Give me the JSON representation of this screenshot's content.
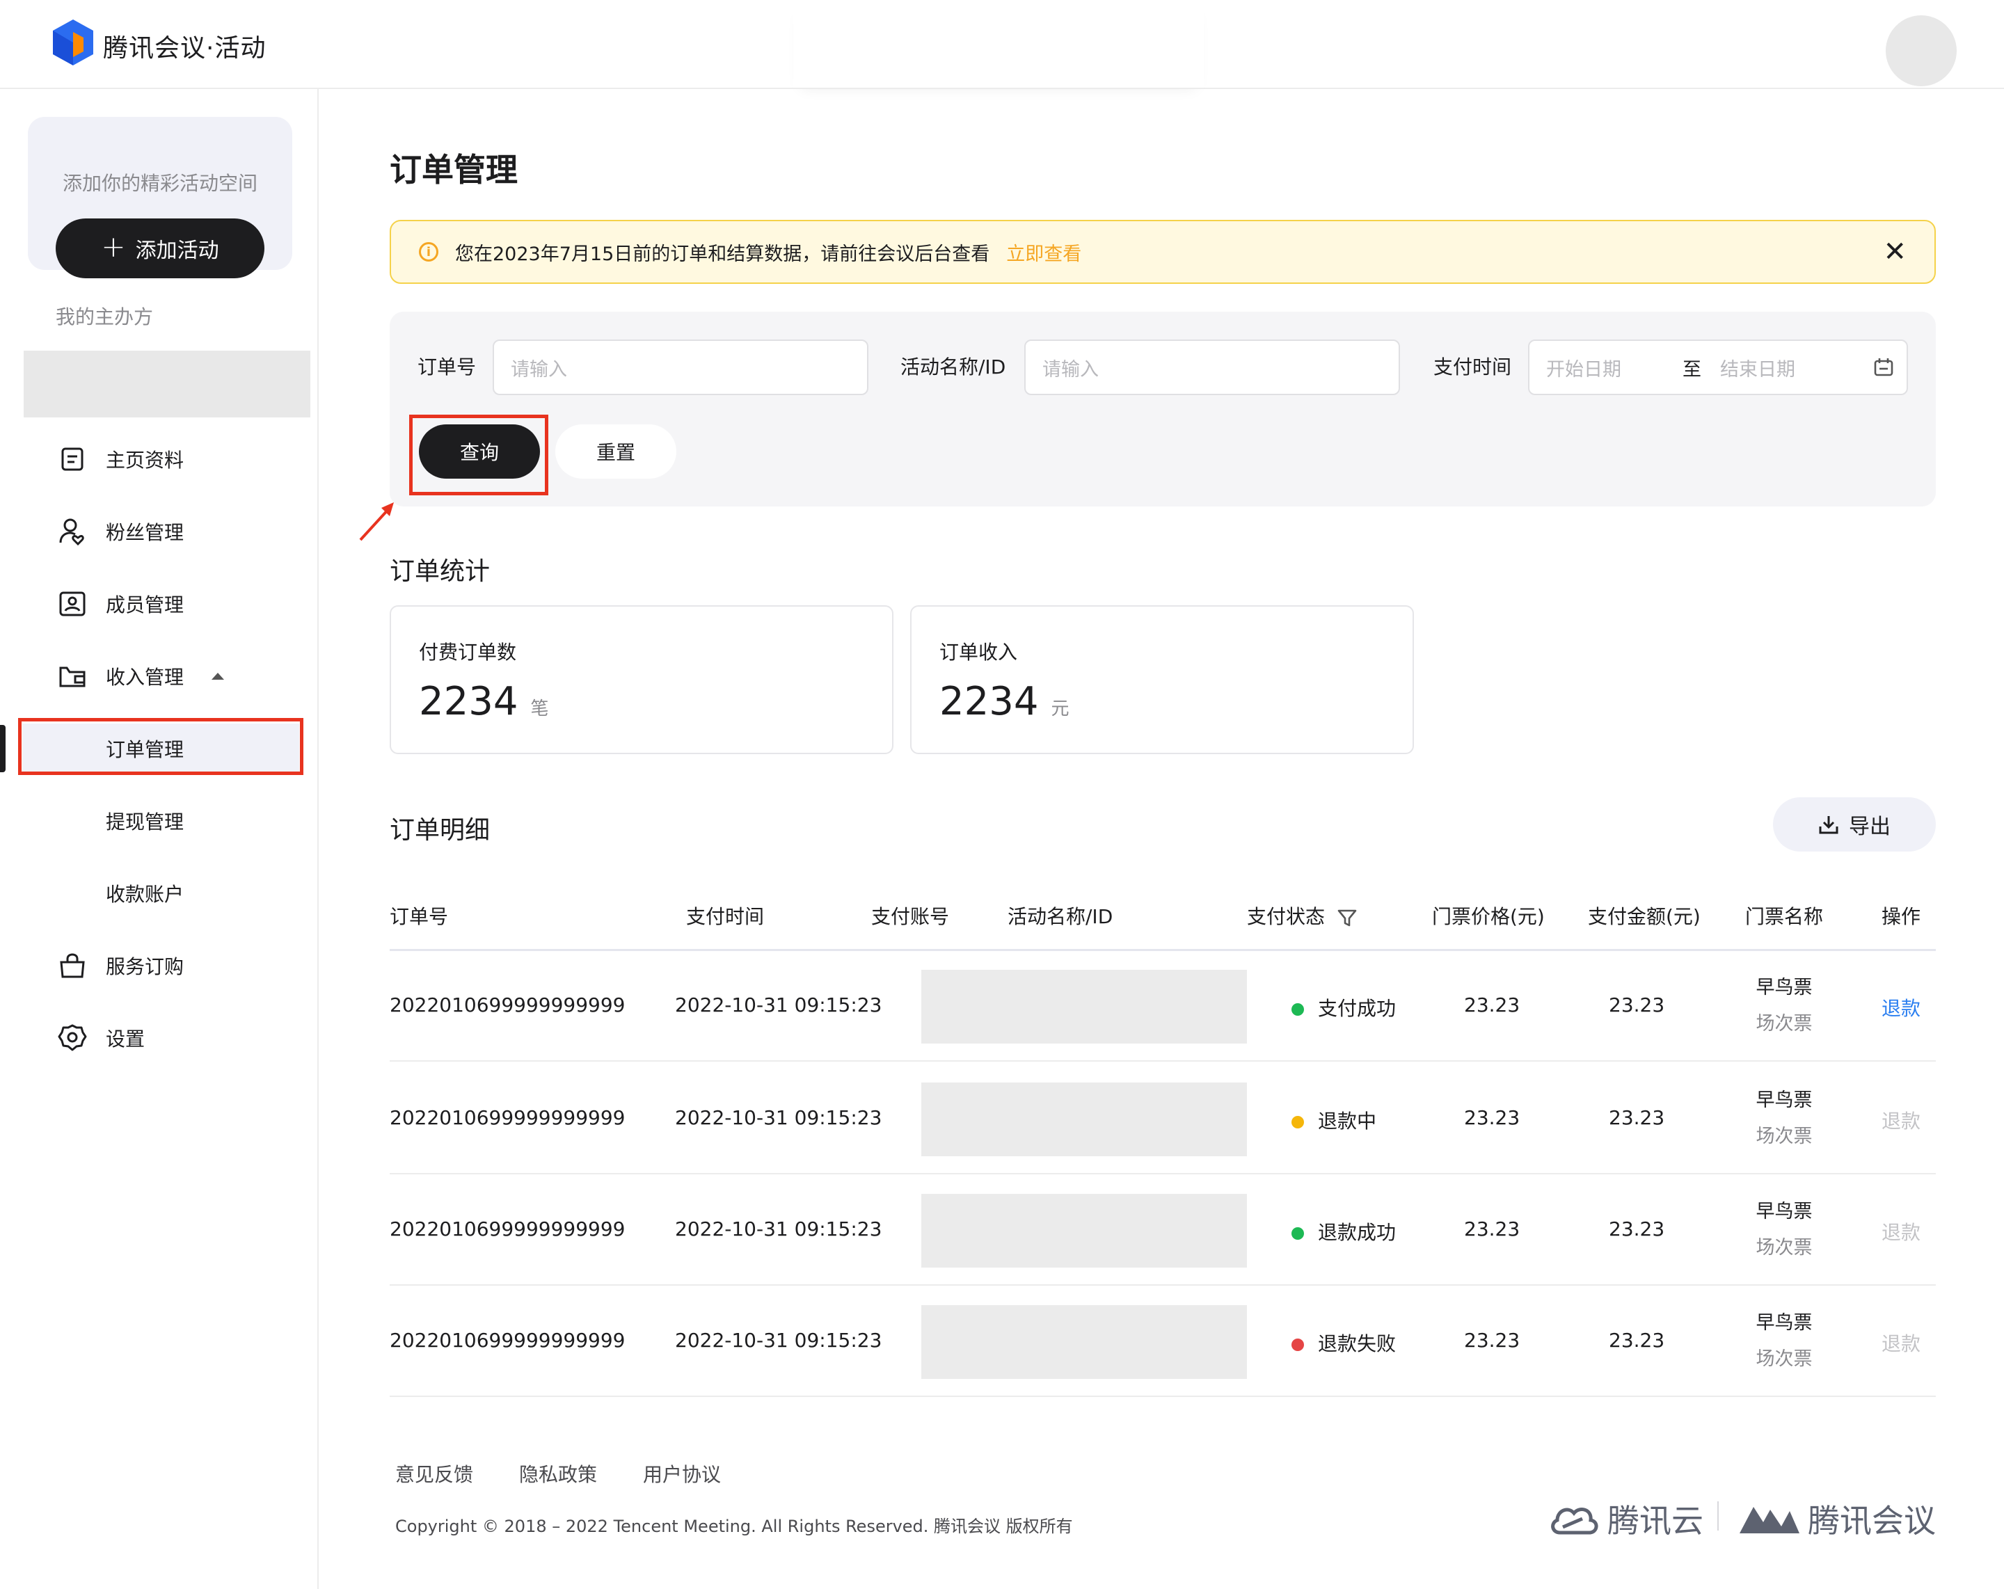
{
  "app": {
    "brand": "腾讯会议·活动"
  },
  "sidebar": {
    "promo_text": "添加你的精彩活动空间",
    "add_button": "添加活动",
    "org_label": "我的主办方",
    "items": [
      {
        "label": "主页资料",
        "icon": "document-icon"
      },
      {
        "label": "粉丝管理",
        "icon": "user-heart-icon"
      },
      {
        "label": "成员管理",
        "icon": "member-card-icon"
      },
      {
        "label": "收入管理",
        "icon": "wallet-icon"
      },
      {
        "label": "服务订购",
        "icon": "shopping-bag-icon"
      },
      {
        "label": "设置",
        "icon": "gear-icon"
      }
    ],
    "sub_items": [
      {
        "label": "订单管理",
        "active": true
      },
      {
        "label": "提现管理"
      },
      {
        "label": "收款账户"
      }
    ]
  },
  "page": {
    "title": "订单管理"
  },
  "notice": {
    "text": "您在2023年7月15日前的订单和结算数据，请前往会议后台查看",
    "link": "立即查看",
    "close": "✕"
  },
  "filters": {
    "order_no_label": "订单号",
    "order_no_placeholder": "请输入",
    "activity_label": "活动名称/ID",
    "activity_placeholder": "请输入",
    "pay_time_label": "支付时间",
    "start_placeholder": "开始日期",
    "to": "至",
    "end_placeholder": "结束日期",
    "query_button": "查询",
    "reset_button": "重置"
  },
  "stats": {
    "title": "订单统计",
    "cards": [
      {
        "label": "付费订单数",
        "value": "2234",
        "unit": "笔"
      },
      {
        "label": "订单收入",
        "value": "2234",
        "unit": "元"
      }
    ]
  },
  "details": {
    "title": "订单明细",
    "export_button": "导出",
    "columns": [
      "订单号",
      "支付时间",
      "支付账号",
      "活动名称/ID",
      "支付状态",
      "门票价格(元)",
      "支付金额(元)",
      "门票名称",
      "操作"
    ],
    "rows": [
      {
        "order_no": "2022010699999999999",
        "pay_time": "2022-10-31 09:15:23",
        "status": "支付成功",
        "status_color": "#1db954",
        "price": "23.23",
        "amount": "23.23",
        "ticket_line1": "早鸟票",
        "ticket_line2": "场次票",
        "action": "退款",
        "action_enabled": true
      },
      {
        "order_no": "2022010699999999999",
        "pay_time": "2022-10-31 09:15:23",
        "status": "退款中",
        "status_color": "#f5b60a",
        "price": "23.23",
        "amount": "23.23",
        "ticket_line1": "早鸟票",
        "ticket_line2": "场次票",
        "action": "退款",
        "action_enabled": false
      },
      {
        "order_no": "2022010699999999999",
        "pay_time": "2022-10-31 09:15:23",
        "status": "退款成功",
        "status_color": "#1db954",
        "price": "23.23",
        "amount": "23.23",
        "ticket_line1": "早鸟票",
        "ticket_line2": "场次票",
        "action": "退款",
        "action_enabled": false
      },
      {
        "order_no": "2022010699999999999",
        "pay_time": "2022-10-31 09:15:23",
        "status": "退款失败",
        "status_color": "#e54545",
        "price": "23.23",
        "amount": "23.23",
        "ticket_line1": "早鸟票",
        "ticket_line2": "场次票",
        "action": "退款",
        "action_enabled": false
      }
    ]
  },
  "footer": {
    "links": [
      "意见反馈",
      "隐私政策",
      "用户协议"
    ],
    "copyright": "Copyright © 2018 – 2022  Tencent Meeting. All Rights Reserved. 腾讯会议 版权所有",
    "brand_cloud": "腾讯云",
    "brand_meeting": "腾讯会议"
  },
  "colors": {
    "accent": "#1d1d1f",
    "warning": "#f5a623",
    "link": "#2b7ff0",
    "highlight": "#e8331f"
  }
}
